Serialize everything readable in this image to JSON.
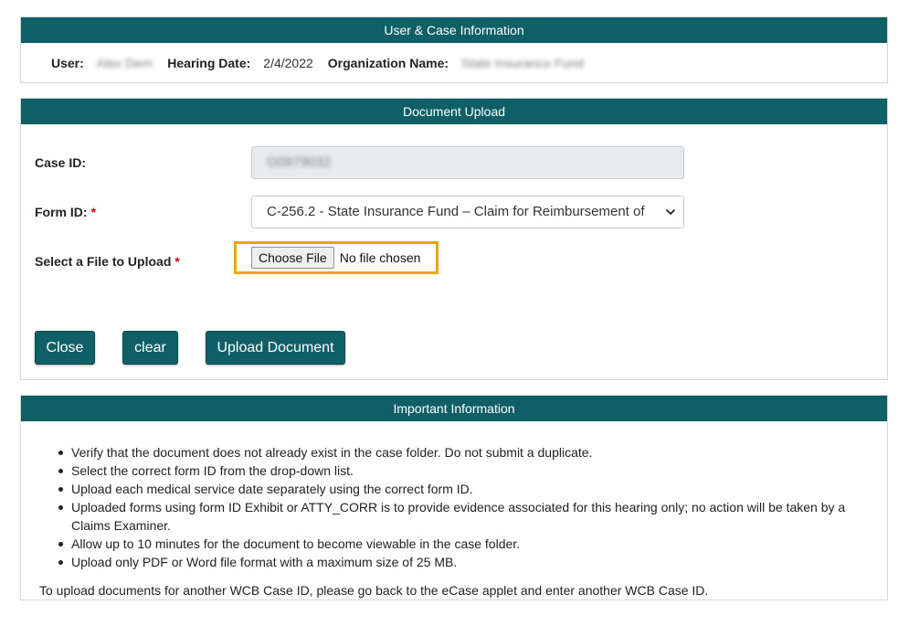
{
  "user_case_panel": {
    "title": "User & Case Information",
    "user_label": "User:",
    "user_value": "Alex Dern",
    "hearing_date_label": "Hearing Date:",
    "hearing_date_value": "2/4/2022",
    "org_label": "Organization Name:",
    "org_value": "State Insurance Fund"
  },
  "upload_panel": {
    "title": "Document Upload",
    "case_id_label": "Case ID:",
    "case_id_value": "G0979032",
    "form_id_label": "Form ID:",
    "form_id_selected": "C-256.2 - State Insurance Fund – Claim for Reimbursement of",
    "file_label": "Select a File to Upload",
    "required_marker": "*",
    "file_button_label": "Choose File",
    "file_status": "No file chosen",
    "buttons": {
      "close": "Close",
      "clear": "clear",
      "upload": "Upload Document"
    }
  },
  "important_panel": {
    "title": "Important Information",
    "items": [
      "Verify that the document does not already exist in the case folder. Do not submit a duplicate.",
      "Select the correct form ID from the drop-down list.",
      "Upload each medical service date separately using the correct form ID.",
      "Uploaded forms using form ID Exhibit or ATTY_CORR is to provide evidence associated for this hearing only; no action will be taken by a Claims Examiner.",
      "Allow up to 10 minutes for the document to become viewable in the case folder.",
      "Upload only PDF or Word file format with a maximum size of 25 MB."
    ],
    "footer_note": "To upload documents for another WCB Case ID, please go back to the eCase applet and enter another WCB Case ID."
  },
  "colors": {
    "header_bg": "#0f5f66",
    "button_bg": "#0f5f66",
    "highlight_border": "#e8a612",
    "required": "#d0021b"
  },
  "icons": {
    "select_arrow": "chevron-down-icon"
  }
}
